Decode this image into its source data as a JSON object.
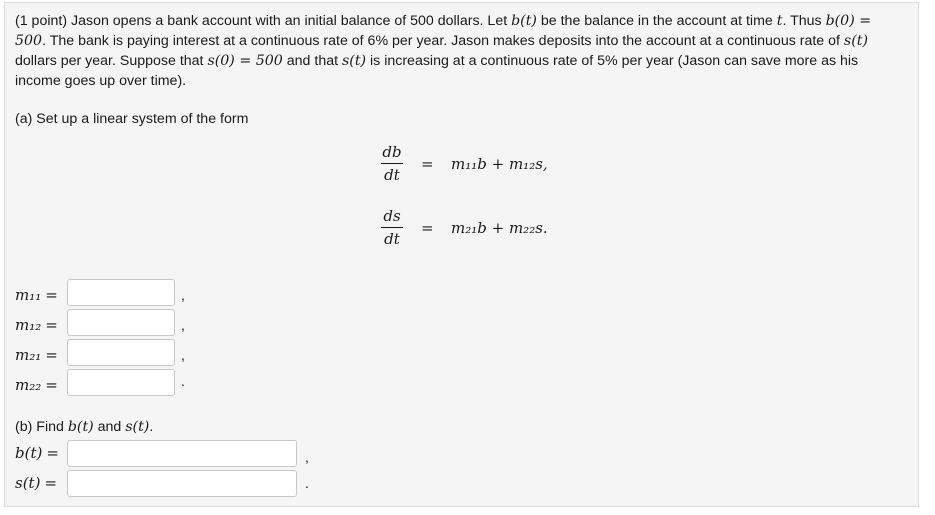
{
  "problem": {
    "intro_p1": "(1 point) Jason opens a bank account with an initial balance of 500 dollars. Let ",
    "b_of_t": "b(t)",
    "intro_p2": " be the balance in the account at time ",
    "t": "t",
    "intro_p3": ". Thus ",
    "b0_eq": "b(0) = 500",
    "intro_p4": ". The bank is paying interest at a continuous rate of 6% per year. Jason makes deposits into the account at a continuous rate of ",
    "s_of_t": "s(t)",
    "intro_p5": " dollars per year. Suppose that ",
    "s0_eq": "s(0) = 500",
    "intro_p6": " and that ",
    "s_of_t_2": "s(t)",
    "intro_p7": " is increasing at a continuous rate of 5% per year (Jason can save more as his income goes up over time)."
  },
  "part_a": {
    "label": "(a) Set up a linear system of the form",
    "eq1": {
      "num": "db",
      "den": "dt",
      "equals": "=",
      "rhs": "m₁₁b + m₁₂s,"
    },
    "eq2": {
      "num": "ds",
      "den": "dt",
      "equals": "=",
      "rhs": "m₂₁b + m₂₂s."
    },
    "inputs": [
      {
        "label": "m₁₁",
        "equals": "=",
        "value": "",
        "punct": ","
      },
      {
        "label": "m₁₂",
        "equals": "=",
        "value": "",
        "punct": ","
      },
      {
        "label": "m₂₁",
        "equals": "=",
        "value": "",
        "punct": ","
      },
      {
        "label": "m₂₂",
        "equals": "=",
        "value": "",
        "punct": "."
      }
    ]
  },
  "part_b": {
    "label_p1": "(b) Find ",
    "b_of_t": "b(t)",
    "label_p2": " and ",
    "s_of_t": "s(t)",
    "label_p3": ".",
    "inputs": [
      {
        "label": "b(t)",
        "equals": "=",
        "value": "",
        "punct": ","
      },
      {
        "label": "s(t)",
        "equals": "=",
        "value": "",
        "punct": "."
      }
    ]
  }
}
